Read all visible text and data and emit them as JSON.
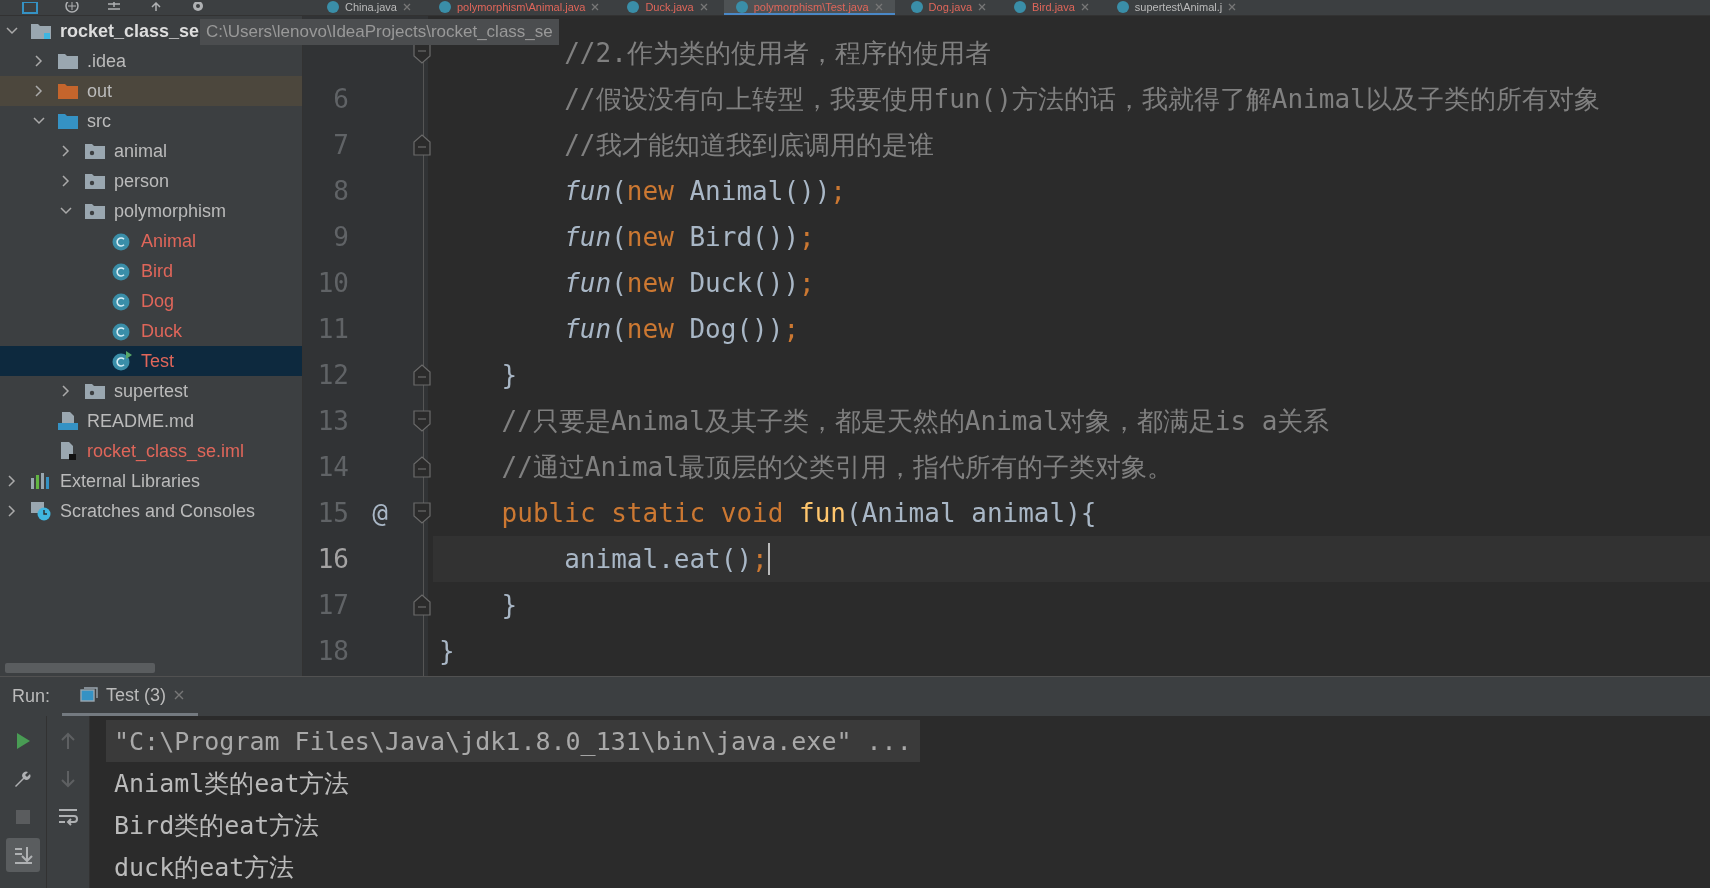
{
  "editor_tabs": [
    {
      "label": "China.java",
      "color": "#bbbbbb",
      "selected": false
    },
    {
      "label": "polymorphism\\Animal.java",
      "color": "#e0665a",
      "selected": false
    },
    {
      "label": "Duck.java",
      "color": "#e0665a",
      "selected": false
    },
    {
      "label": "polymorphism\\Test.java",
      "color": "#e0665a",
      "selected": true
    },
    {
      "label": "Dog.java",
      "color": "#e0665a",
      "selected": false
    },
    {
      "label": "Bird.java",
      "color": "#e0665a",
      "selected": false
    },
    {
      "label": "supertest\\Animal.j",
      "color": "#bbbbbb",
      "selected": false
    }
  ],
  "project_tree": {
    "tooltip": "C:\\Users\\lenovo\\IdeaProjects\\rocket_class_se",
    "items": [
      {
        "label": "rocket_class_se",
        "kind": "module",
        "expanded": true,
        "selected": false,
        "color": "#dddddd",
        "children": [
          {
            "label": ".idea",
            "kind": "folder",
            "expanded": false,
            "selected": false,
            "color": "#bbbbbb"
          },
          {
            "label": "out",
            "kind": "excluded-folder",
            "expanded": false,
            "selected": false,
            "color": "#bbbbbb"
          },
          {
            "label": "src",
            "kind": "source-folder",
            "expanded": true,
            "selected": false,
            "color": "#bbbbbb",
            "children": [
              {
                "label": "animal",
                "kind": "package",
                "expanded": false,
                "selected": false,
                "color": "#bbbbbb"
              },
              {
                "label": "person",
                "kind": "package",
                "expanded": false,
                "selected": false,
                "color": "#bbbbbb"
              },
              {
                "label": "polymorphism",
                "kind": "package",
                "expanded": true,
                "selected": false,
                "color": "#bbbbbb",
                "children": [
                  {
                    "label": "Animal",
                    "kind": "class",
                    "selected": false,
                    "color": "#e0665a"
                  },
                  {
                    "label": "Bird",
                    "kind": "class",
                    "selected": false,
                    "color": "#e0665a"
                  },
                  {
                    "label": "Dog",
                    "kind": "class",
                    "selected": false,
                    "color": "#e0665a"
                  },
                  {
                    "label": "Duck",
                    "kind": "class",
                    "selected": false,
                    "color": "#e0665a"
                  },
                  {
                    "label": "Test",
                    "kind": "main-class",
                    "selected": true,
                    "color": "#e0665a"
                  }
                ]
              },
              {
                "label": "supertest",
                "kind": "package",
                "expanded": false,
                "selected": false,
                "color": "#bbbbbb"
              }
            ]
          },
          {
            "label": "README.md",
            "kind": "markdown",
            "selected": false,
            "color": "#bbbbbb"
          },
          {
            "label": "rocket_class_se.iml",
            "kind": "iml",
            "selected": false,
            "color": "#e0665a"
          }
        ]
      },
      {
        "label": "External Libraries",
        "kind": "libraries",
        "expanded": false,
        "selected": false,
        "color": "#bbbbbb"
      },
      {
        "label": "Scratches and Consoles",
        "kind": "scratches",
        "expanded": false,
        "selected": false,
        "color": "#bbbbbb"
      }
    ]
  },
  "code_lines": [
    {
      "kind": "fold-start",
      "current": false,
      "tokens": [
        {
          "kind": "comment",
          "text": "        //2.作为类的使用者，程序的使用者"
        }
      ]
    },
    {
      "number": "6",
      "kind": "plain",
      "current": false,
      "tokens": [
        {
          "kind": "comment",
          "text": "        //假设没有向上转型，我要使用fun()方法的话，我就得了解Animal以及子类的所有对象"
        }
      ]
    },
    {
      "number": "7",
      "kind": "fold-end",
      "current": false,
      "tokens": [
        {
          "kind": "comment",
          "text": "        //我才能知道我到底调用的是谁"
        }
      ]
    },
    {
      "number": "8",
      "kind": "plain",
      "current": false,
      "tokens": [
        {
          "kind": "call",
          "text": "        fun"
        },
        {
          "kind": "plain",
          "text": "("
        },
        {
          "kind": "keyword",
          "text": "new"
        },
        {
          "kind": "plain",
          "text": " Animal())"
        },
        {
          "kind": "keyword",
          "text": ";"
        }
      ]
    },
    {
      "number": "9",
      "kind": "plain",
      "current": false,
      "tokens": [
        {
          "kind": "call",
          "text": "        fun"
        },
        {
          "kind": "plain",
          "text": "("
        },
        {
          "kind": "keyword",
          "text": "new"
        },
        {
          "kind": "plain",
          "text": " Bird())"
        },
        {
          "kind": "keyword",
          "text": ";"
        }
      ]
    },
    {
      "number": "10",
      "kind": "plain",
      "current": false,
      "tokens": [
        {
          "kind": "call",
          "text": "        fun"
        },
        {
          "kind": "plain",
          "text": "("
        },
        {
          "kind": "keyword",
          "text": "new"
        },
        {
          "kind": "plain",
          "text": " Duck())"
        },
        {
          "kind": "keyword",
          "text": ";"
        }
      ]
    },
    {
      "number": "11",
      "kind": "plain",
      "current": false,
      "tokens": [
        {
          "kind": "call",
          "text": "        fun"
        },
        {
          "kind": "plain",
          "text": "("
        },
        {
          "kind": "keyword",
          "text": "new"
        },
        {
          "kind": "plain",
          "text": " Dog())"
        },
        {
          "kind": "keyword",
          "text": ";"
        }
      ]
    },
    {
      "number": "12",
      "kind": "fold-end",
      "current": false,
      "tokens": [
        {
          "kind": "plain",
          "text": "    }"
        }
      ]
    },
    {
      "number": "13",
      "kind": "fold-start",
      "current": false,
      "tokens": [
        {
          "kind": "comment",
          "text": "    //只要是Animal及其子类，都是天然的Animal对象，都满足is a关系"
        }
      ]
    },
    {
      "number": "14",
      "kind": "fold-end",
      "current": false,
      "tokens": [
        {
          "kind": "comment",
          "text": "    //通过Animal最顶层的父类引用，指代所有的子类对象。"
        }
      ]
    },
    {
      "number": "15",
      "kind": "fold-start",
      "current": false,
      "annotation": "@",
      "tokens": [
        {
          "kind": "keyword",
          "text": "    public static void "
        },
        {
          "kind": "declaration",
          "text": "fun"
        },
        {
          "kind": "plain",
          "text": "(Animal animal){"
        }
      ]
    },
    {
      "number": "16",
      "kind": "plain",
      "current": true,
      "tokens": [
        {
          "kind": "plain",
          "text": "        animal.eat()"
        },
        {
          "kind": "keyword",
          "text": ";"
        }
      ]
    },
    {
      "number": "17",
      "kind": "fold-end",
      "current": false,
      "tokens": [
        {
          "kind": "plain",
          "text": "    }"
        }
      ]
    },
    {
      "number": "18",
      "kind": "plain",
      "current": false,
      "tokens": [
        {
          "kind": "plain",
          "text": "}"
        }
      ]
    }
  ],
  "run_panel": {
    "label": "Run:",
    "tabs": [
      {
        "label": "Test (3)",
        "selected": true
      }
    ],
    "toolbar": [
      {
        "kind": "rerun",
        "disabled": false
      },
      {
        "kind": "up",
        "disabled": true
      },
      {
        "kind": "settings",
        "disabled": false
      },
      {
        "kind": "down",
        "disabled": true
      },
      {
        "kind": "stop",
        "disabled": true
      },
      {
        "kind": "soft-wrap",
        "on": false
      },
      {
        "kind": "scroll-to-end",
        "on": true
      }
    ],
    "console": [
      {
        "kind": "command",
        "text": "\"C:\\Program Files\\Java\\jdk1.8.0_131\\bin\\java.exe\" ..."
      },
      {
        "kind": "output",
        "text": "Aniaml类的eat方法"
      },
      {
        "kind": "output",
        "text": "Bird类的eat方法"
      },
      {
        "kind": "output",
        "text": "duck的eat方法"
      }
    ]
  }
}
